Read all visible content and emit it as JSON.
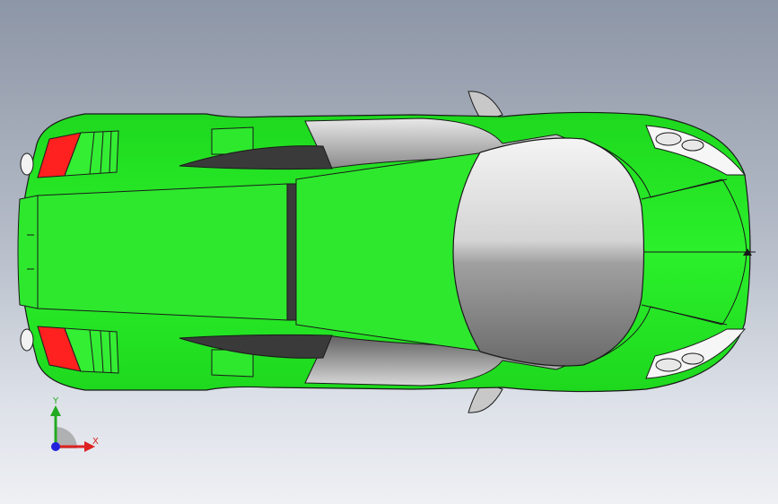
{
  "viewport": {
    "background_top": "#8d96a6",
    "background_bottom": "#eef0f4"
  },
  "model": {
    "body_color": "#22ee22",
    "glass_color": "#b8b8b8",
    "taillight_color": "#ff2020",
    "edge_color": "#1a1a1a"
  },
  "triad": {
    "y_label": "Y",
    "x_label": "X",
    "y_color": "#22aa22",
    "x_color": "#dd2222",
    "origin_color": "#2222dd"
  }
}
